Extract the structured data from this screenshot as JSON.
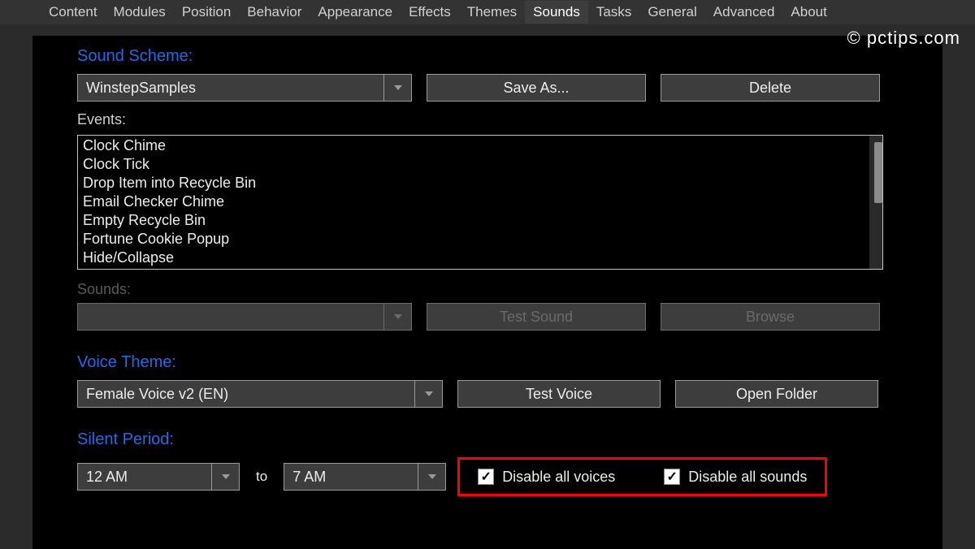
{
  "tabs": [
    "Content",
    "Modules",
    "Position",
    "Behavior",
    "Appearance",
    "Effects",
    "Themes",
    "Sounds",
    "Tasks",
    "General",
    "Advanced",
    "About"
  ],
  "active_tab": "Sounds",
  "watermark": "© pctips.com",
  "sound_scheme": {
    "label": "Sound Scheme:",
    "value": "WinstepSamples",
    "save_as_label": "Save As...",
    "delete_label": "Delete"
  },
  "events": {
    "label": "Events:",
    "items": [
      "Clock Chime",
      "Clock Tick",
      "Drop Item into Recycle Bin",
      "Email Checker Chime",
      "Empty Recycle Bin",
      "Fortune Cookie Popup",
      "Hide/Collapse"
    ]
  },
  "sounds": {
    "label": "Sounds:",
    "value": "",
    "test_label": "Test Sound",
    "browse_label": "Browse"
  },
  "voice_theme": {
    "label": "Voice Theme:",
    "value": "Female Voice v2 (EN)",
    "test_label": "Test Voice",
    "open_folder_label": "Open Folder"
  },
  "silent_period": {
    "label": "Silent Period:",
    "from_value": "12 AM",
    "to_label": "to",
    "to_value": "7 AM",
    "disable_voices_label": "Disable all voices",
    "disable_voices_checked": true,
    "disable_sounds_label": "Disable all sounds",
    "disable_sounds_checked": true
  }
}
